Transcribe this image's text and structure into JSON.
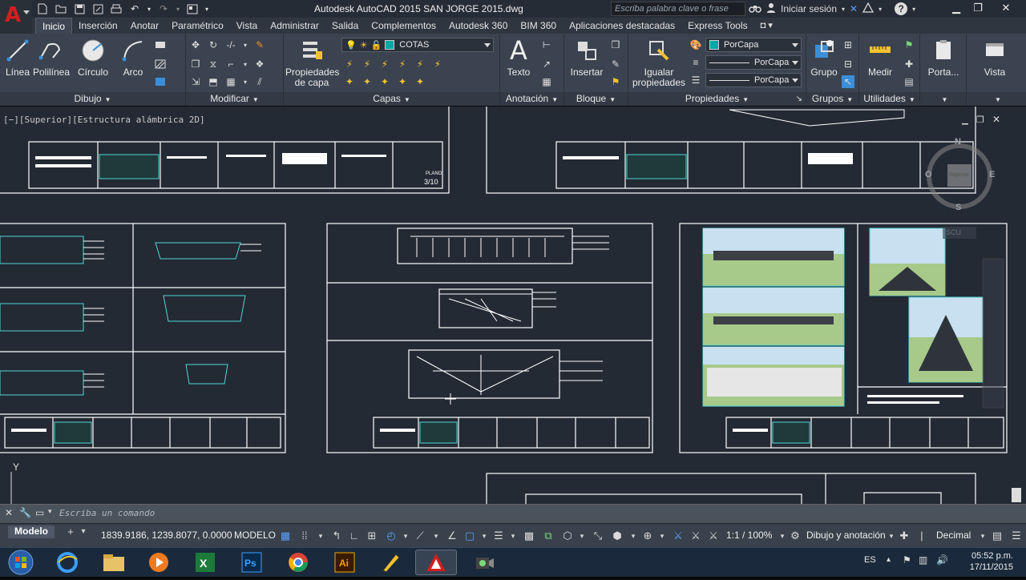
{
  "window": {
    "title": "Autodesk AutoCAD 2015    SAN JORGE 2015.dwg",
    "search_placeholder": "Escriba palabra clave o frase",
    "login_label": "Iniciar sesión"
  },
  "tabs": [
    "Inicio",
    "Inserción",
    "Anotar",
    "Paramétrico",
    "Vista",
    "Administrar",
    "Salida",
    "Complementos",
    "Autodesk 360",
    "BIM 360",
    "Aplicaciones destacadas",
    "Express Tools"
  ],
  "ribbon": {
    "dibujo": {
      "title": "Dibujo",
      "linea": "Línea",
      "polilinea": "Polilínea",
      "circulo": "Círculo",
      "arco": "Arco"
    },
    "modificar": {
      "title": "Modificar"
    },
    "capas": {
      "title": "Capas",
      "propiedades_line1": "Propiedades",
      "propiedades_line2": "de capa",
      "current_layer": "COTAS"
    },
    "anotacion": {
      "title": "Anotación",
      "texto": "Texto"
    },
    "bloque": {
      "title": "Bloque",
      "insertar": "Insertar"
    },
    "propiedades": {
      "title": "Propiedades",
      "igualar_line1": "Igualar",
      "igualar_line2": "propiedades",
      "color": "PorCapa",
      "linetype": "PorCapa",
      "lineweight": "PorCapa"
    },
    "grupos": {
      "title": "Grupos",
      "grupo": "Grupo"
    },
    "utilidades": {
      "title": "Utilidades",
      "medir": "Medir"
    },
    "porta": {
      "label": "Porta..."
    },
    "vista": {
      "label": "Vista"
    }
  },
  "viewport": {
    "label": "[−][Superior][Estructura alámbrica 2D]",
    "sheet_label": "PLANO",
    "sheet_number": "3/10",
    "compass": {
      "n": "N",
      "s": "S",
      "e": "E",
      "o": "O",
      "center": "Superior"
    },
    "wcs": "SCU"
  },
  "command_line": {
    "placeholder": "Escriba un comando"
  },
  "status": {
    "layout_tab": "Modelo",
    "coordinates": "1839.9186, 1239.8077, 0.0000",
    "space": "MODELO",
    "scale": "1:1 / 100%",
    "workspace": "Dibujo y anotación",
    "units": "Decimal"
  },
  "taskbar": {
    "language": "ES",
    "time": "05:52 p.m.",
    "date": "17/11/2015"
  },
  "colors": {
    "drawing_bg": "#232a34",
    "ribbon_bg": "#3b4350",
    "titlebar_bg": "#262c36",
    "autocad_red": "#d21f1f",
    "layer_swatch": "#00a8a8"
  }
}
